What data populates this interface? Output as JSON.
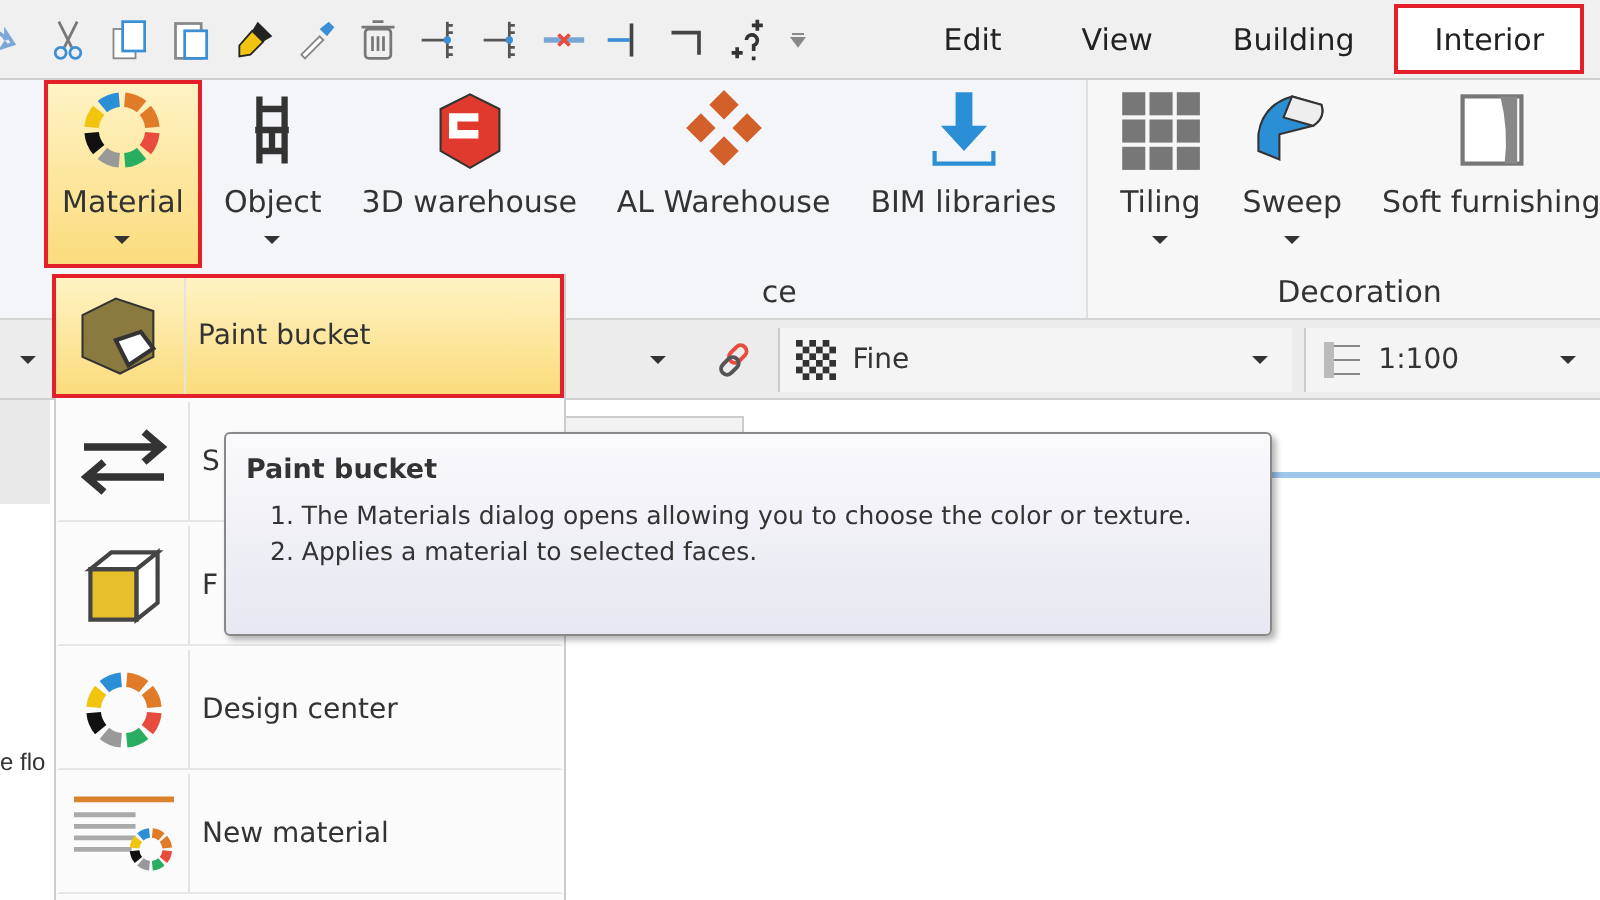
{
  "tabs": [
    {
      "label": "Edit",
      "selected": false
    },
    {
      "label": "View",
      "selected": false
    },
    {
      "label": "Building",
      "selected": false
    },
    {
      "label": "Interior",
      "selected": true
    }
  ],
  "ribbon": {
    "groups": [
      {
        "label": "ce",
        "buttons": [
          {
            "label": "Material",
            "dropdown": true,
            "selected": true
          },
          {
            "label": "Object",
            "dropdown": true,
            "selected": false
          },
          {
            "label": "3D warehouse",
            "dropdown": false,
            "selected": false
          },
          {
            "label": "AL Warehouse",
            "dropdown": false,
            "selected": false
          },
          {
            "label": "BIM libraries",
            "dropdown": false,
            "selected": false
          }
        ]
      },
      {
        "label": "Decoration",
        "buttons": [
          {
            "label": "Tiling",
            "dropdown": true,
            "selected": false
          },
          {
            "label": "Sweep",
            "dropdown": true,
            "selected": false
          },
          {
            "label": "Soft furnishing",
            "dropdown": false,
            "selected": false
          }
        ]
      }
    ]
  },
  "toolbar": {
    "fields": [
      {
        "value": "Fine"
      },
      {
        "value": "1:100"
      }
    ]
  },
  "side_text": "e flo",
  "menu": {
    "items": [
      {
        "label": "Paint bucket",
        "selected": true
      },
      {
        "label": "S",
        "selected": false
      },
      {
        "label": "F",
        "selected": false
      },
      {
        "label": "Design center",
        "selected": false
      },
      {
        "label": "New material",
        "selected": false
      }
    ]
  },
  "tooltip": {
    "title": "Paint bucket",
    "lines": [
      "1. The Materials dialog opens allowing you to choose the color or texture.",
      "2. Applies a material to selected faces."
    ]
  }
}
